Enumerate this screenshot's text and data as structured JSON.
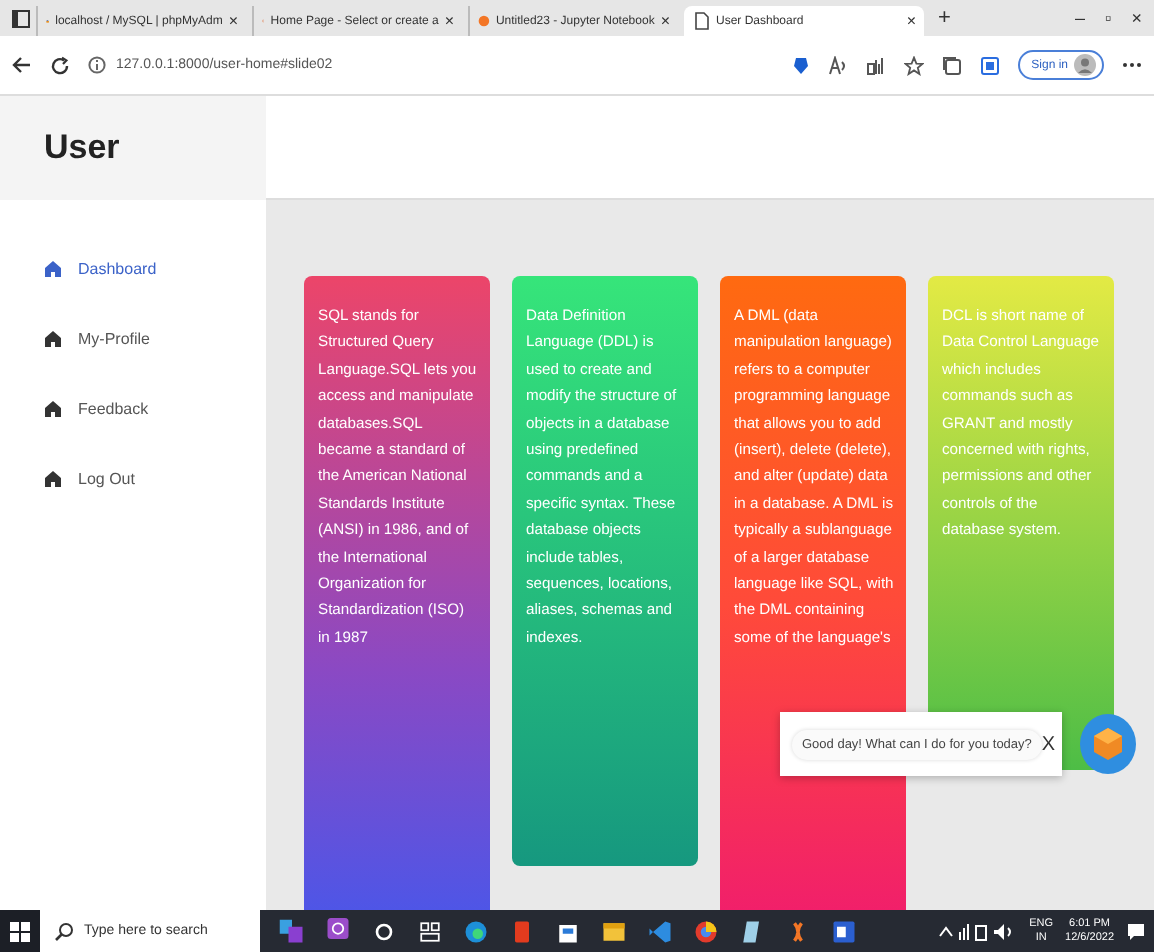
{
  "browser": {
    "tabs": [
      {
        "title": "localhost / MySQL | phpMyAdm",
        "close": "×",
        "selected": false
      },
      {
        "title": "Home Page - Select or create a",
        "close": "×",
        "selected": false
      },
      {
        "title": "Untitled23 - Jupyter Notebook",
        "close": "×",
        "selected": false
      },
      {
        "title": "User Dashboard",
        "close": "×",
        "selected": true
      }
    ],
    "new_tab": "+",
    "window_controls": [
      "–",
      "▫",
      "×"
    ],
    "url": "127.0.0.1:8000/user-home#slide02",
    "sign_in": "Sign in"
  },
  "sidebar": {
    "title": "User",
    "items": [
      {
        "label": "Dashboard",
        "selected": true
      },
      {
        "label": "My-Profile",
        "selected": false
      },
      {
        "label": "Feedback",
        "selected": false
      },
      {
        "label": "Log Out",
        "selected": false
      }
    ]
  },
  "cards": [
    {
      "text": "SQL stands for Structured Query Language.SQL lets you access and manipulate databases.SQL became a standard of the American National Standards Institute (ANSI) in 1986, and of the International Organization for Standardization (ISO) in 1987"
    },
    {
      "text": "Data Definition Language (DDL) is used to create and modify the structure of objects in a database using predefined commands and a specific syntax. These database objects include tables, sequences, locations, aliases, schemas and indexes."
    },
    {
      "text": "A DML (data manipulation language) refers to a computer programming language that allows you to add (insert), delete (delete), and alter (update) data in a database. A DML is typically a sublanguage of a larger database language like SQL, with the DML containing some of the language's"
    },
    {
      "text": "DCL is short name of Data Control Language which includes commands such as GRANT and mostly concerned with rights, permissions and other controls of the database system."
    }
  ],
  "chat": {
    "message": "Good day! What can I do for you today?",
    "close": "X"
  },
  "taskbar": {
    "search_placeholder": "Type here to search",
    "language": "ENG",
    "region": "IN",
    "time": "6:01 PM",
    "date": "12/6/2022"
  }
}
